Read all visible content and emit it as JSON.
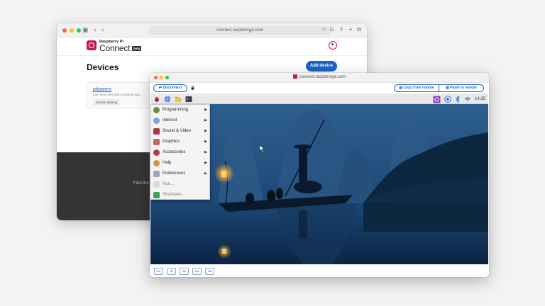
{
  "back_window": {
    "url": "connect.raspberrypi.com",
    "brand": {
      "top": "Raspberry Pi",
      "main": "Connect",
      "badge": "beta"
    },
    "page_title": "Devices",
    "add_device_label": "Add device",
    "device": {
      "name": "pitowers",
      "last_seen": "Last seen less than a minute ago",
      "badge": "Screen sharing"
    },
    "footer_text": "Find the"
  },
  "front_window": {
    "url": "connect.raspberrypi.com",
    "toolbar": {
      "disconnect_label": "Disconnect",
      "copy_label": "Copy from remote",
      "paste_label": "Paste to remote"
    },
    "desktop": {
      "clock": "14:25",
      "menu_items": [
        {
          "label": "Programming",
          "submenu": true
        },
        {
          "label": "Internet",
          "submenu": true
        },
        {
          "label": "Sound & Video",
          "submenu": true
        },
        {
          "label": "Graphics",
          "submenu": true
        },
        {
          "label": "Accessories",
          "submenu": true
        },
        {
          "label": "Help",
          "submenu": true
        },
        {
          "label": "Preferences",
          "submenu": true
        },
        {
          "label": "Run...",
          "submenu": false
        },
        {
          "label": "Shutdown...",
          "submenu": false
        }
      ]
    },
    "keys": [
      "Ctrl",
      "⊞",
      "Alt",
      "Esc",
      "Tab"
    ]
  },
  "colors": {
    "accent": "#1e63c4",
    "raspberry": "#c51a4a",
    "footer_dark": "#353535"
  }
}
